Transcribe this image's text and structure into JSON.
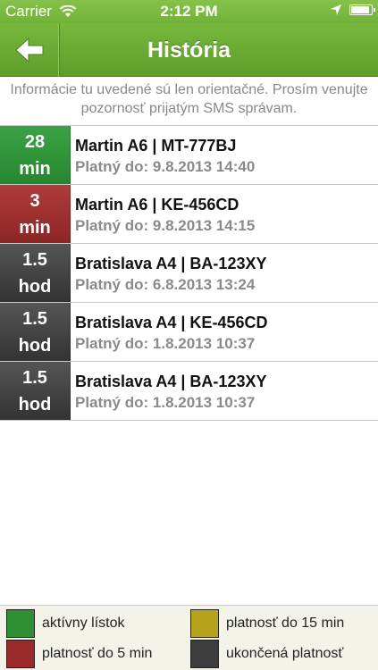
{
  "status_bar": {
    "carrier": "Carrier",
    "time": "2:12 PM",
    "battery_level": 0.95
  },
  "nav": {
    "title": "História",
    "back_icon": "arrow-left-icon"
  },
  "notice": "Informácie tu uvedené sú len orientačné. Prosím venujte pozornosť prijatým SMS správam.",
  "colors": {
    "active": "#2f8f35",
    "expiring_5": "#9a2a2a",
    "expiring_15": "#b7a21b",
    "ended": "#3d3d3d",
    "header_green": "#72b23a"
  },
  "tickets": [
    {
      "value": "28",
      "unit": "min",
      "status": "green",
      "title": "Martin A6 | MT-777BJ",
      "valid": "Platný do: 9.8.2013 14:40"
    },
    {
      "value": "3",
      "unit": "min",
      "status": "red",
      "title": "Martin A6 | KE-456CD",
      "valid": "Platný do: 9.8.2013 14:15"
    },
    {
      "value": "1.5",
      "unit": "hod",
      "status": "dark",
      "title": "Bratislava A4 | BA-123XY",
      "valid": "Platný do: 6.8.2013 13:24"
    },
    {
      "value": "1.5",
      "unit": "hod",
      "status": "dark",
      "title": "Bratislava A4 | KE-456CD",
      "valid": "Platný do: 1.8.2013 10:37"
    },
    {
      "value": "1.5",
      "unit": "hod",
      "status": "dark",
      "title": "Bratislava A4 | BA-123XY",
      "valid": "Platný do: 1.8.2013 10:37"
    }
  ],
  "legend": [
    {
      "color": "green",
      "label": "aktívny lístok"
    },
    {
      "color": "yellow",
      "label": "platnosť do 15 min"
    },
    {
      "color": "red",
      "label": "platnosť do 5 min"
    },
    {
      "color": "dark",
      "label": "ukončená platnosť"
    }
  ]
}
